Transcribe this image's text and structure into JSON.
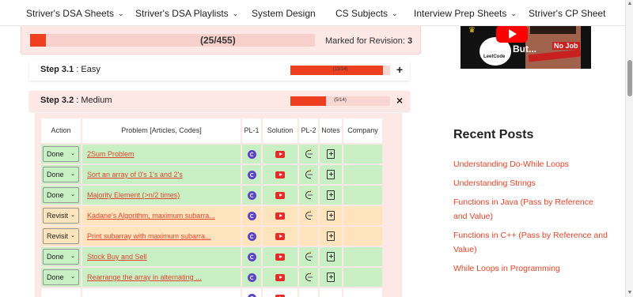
{
  "nav": {
    "items": [
      {
        "label": "Striver's DSA Sheets",
        "dropdown": true
      },
      {
        "label": "Striver's DSA Playlists",
        "dropdown": true
      },
      {
        "label": "System Design",
        "dropdown": false
      },
      {
        "label": "CS Subjects",
        "dropdown": true
      },
      {
        "label": "Interview Prep Sheets",
        "dropdown": true
      },
      {
        "label": "Striver's CP Sheet",
        "dropdown": false
      }
    ]
  },
  "progress": {
    "count": "(25/455)",
    "fraction": 0.055,
    "marked_label": "Marked for Revision:",
    "marked_value": "3"
  },
  "steps": [
    {
      "name": "Step 3.1",
      "level": "Easy",
      "progress_text": "(13/14)",
      "fraction": 0.93,
      "toggle": "+"
    },
    {
      "name": "Step 3.2",
      "level": "Medium",
      "progress_text": "(5/14)",
      "fraction": 0.36,
      "toggle": "×"
    }
  ],
  "table": {
    "headers": {
      "action": "Action",
      "problem": "Problem [Articles, Codes]",
      "pl1": "PL-1",
      "solution": "Solution",
      "pl2": "PL-2",
      "notes": "Notes",
      "company": "Company"
    },
    "rows": [
      {
        "status": "Done",
        "problem": "2Sum Problem",
        "pl2": true
      },
      {
        "status": "Done",
        "problem": "Sort an array of 0's 1's and 2's",
        "pl2": true
      },
      {
        "status": "Done",
        "problem": "Majority Element (>n/2 times)",
        "pl2": true
      },
      {
        "status": "Revisit",
        "problem": "Kadane's Algorithm, maximum subarra...",
        "pl2": true
      },
      {
        "status": "Revisit",
        "problem": "Print subarray with maximum subarra...",
        "pl2": false
      },
      {
        "status": "Done",
        "problem": "Stock Buy and Sell",
        "pl2": true
      },
      {
        "status": "Done",
        "problem": "Rearrange the array in alternating ...",
        "pl2": true
      }
    ]
  },
  "sidebar": {
    "thumb_text_1": "But...",
    "thumb_text_2": "No Job",
    "thumb_logo": "LeetCode",
    "recent_title": "Recent Posts",
    "recent_posts": [
      "Understanding Do-While Loops",
      "Understanding Strings",
      "Functions in Java (Pass by Reference and Value)",
      "Functions in C++ (Pass by Reference and Value)",
      "While Loops in Programming"
    ]
  },
  "colors": {
    "accent": "#ee3f21",
    "link": "#e2452b",
    "done_row": "#c9efc4",
    "revisit_row": "#fde4bd",
    "panel": "#fde8e6"
  }
}
